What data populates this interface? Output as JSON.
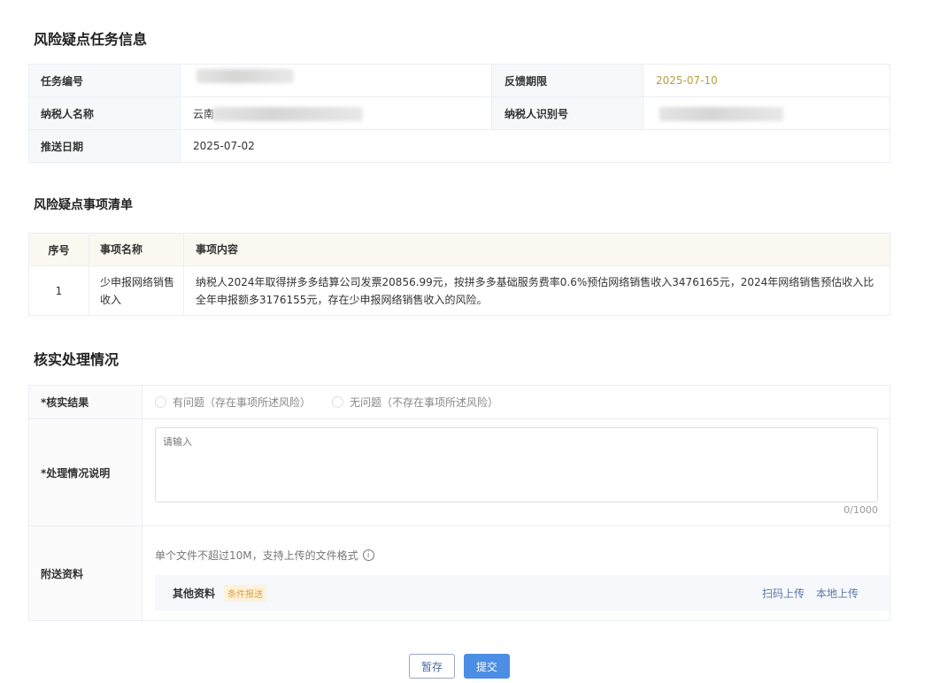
{
  "task_section": {
    "title": "风险疑点任务信息",
    "task_no_label": "任务编号",
    "task_no_value": "",
    "deadline_label": "反馈期限",
    "deadline_value": "2025-07-10",
    "taxpayer_name_label": "纳税人名称",
    "taxpayer_name_value": "云南",
    "taxpayer_id_label": "纳税人识别号",
    "taxpayer_id_value": "",
    "push_date_label": "推送日期",
    "push_date_value": "2025-07-02"
  },
  "issues_section": {
    "title": "风险疑点事项清单",
    "columns": [
      "序号",
      "事项名称",
      "事项内容"
    ],
    "rows": [
      {
        "index": "1",
        "name": "少申报网络销售收入",
        "content": "纳税人2024年取得拼多多结算公司发票20856.99元，按拼多多基础服务费率0.6%预估网络销售收入3476165元，2024年网络销售预估收入比全年申报额多3176155元，存在少申报网络销售收入的风险。"
      }
    ]
  },
  "verify_section": {
    "title": "核实处理情况",
    "result_label": "*核实结果",
    "option_yes": "有问题（存在事项所述风险）",
    "option_no": "无问题（不存在事项所述风险）",
    "desc_label": "*处理情况说明",
    "desc_placeholder": "请输入",
    "desc_counter": "0/1000",
    "attach_label": "附送资料",
    "attach_hint": "单个文件不超过10M，支持上传的文件格式",
    "file_name": "其他资料",
    "file_tag": "条件报送",
    "scan_upload": "扫码上传",
    "local_upload": "本地上传"
  },
  "buttons": {
    "save": "暂存",
    "submit": "提交"
  }
}
